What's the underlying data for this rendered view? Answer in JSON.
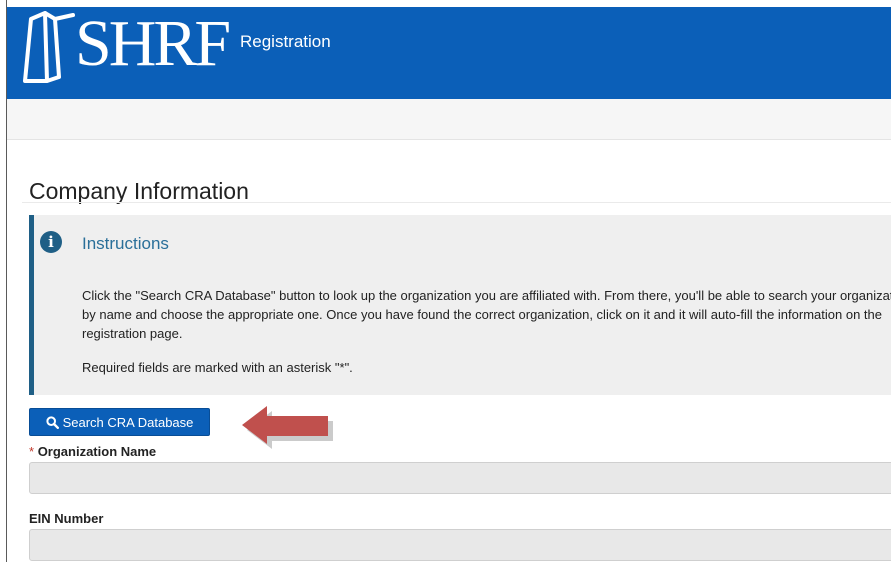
{
  "header": {
    "logo_text": "SHRF",
    "title": "Registration",
    "background": "#0b5fb8"
  },
  "page": {
    "title": "Company Information"
  },
  "instructions": {
    "icon": "info-icon",
    "icon_glyph": "i",
    "heading": "Instructions",
    "body": "Click the \"Search CRA Database\" button to look up the organization you are affiliated with. From there, you'll be able to search your organization by name and choose the appropriate one. Once you have found the correct organization, click on it and it will auto-fill the information on the registration page.",
    "required_note": "Required fields are marked with an asterisk \"*\".",
    "accent_color": "#1f5f86"
  },
  "search_button": {
    "icon": "search-icon",
    "label": "Search CRA Database"
  },
  "annotation_arrow": {
    "color": "#c0504d"
  },
  "fields": {
    "organization_name": {
      "required_marker": "*",
      "label": "Organization Name",
      "value": ""
    },
    "ein_number": {
      "label": "EIN Number",
      "value": ""
    }
  }
}
